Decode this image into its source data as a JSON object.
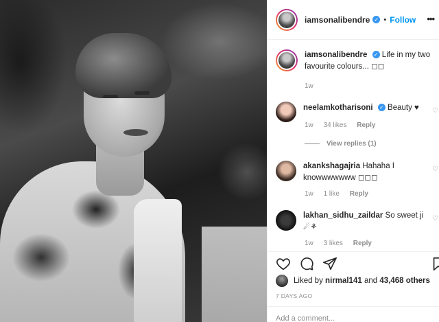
{
  "post": {
    "username": "iamsonalibendre",
    "follow_label": "Follow",
    "more_label": "•••",
    "caption": {
      "username": "iamsonalibendre",
      "text": "Life in my two favourite colours... ◻◻",
      "time": "1w"
    }
  },
  "comments": [
    {
      "username": "neelamkotharisoni",
      "verified": true,
      "text": "Beauty ♥",
      "time": "1w",
      "likes": "34 likes",
      "reply_label": "Reply",
      "view_replies": "View replies (1)"
    },
    {
      "username": "akankshagajria",
      "text": "Hahaha I knowwwwwww ◻◻◻",
      "time": "1w",
      "likes": "1 like",
      "reply_label": "Reply"
    },
    {
      "username": "lakhan_sidhu_zaildar",
      "text": "So sweet ji ☄⚘",
      "time": "1w",
      "likes": "3 likes",
      "reply_label": "Reply"
    }
  ],
  "actions": {
    "like_icon": "heart-icon",
    "comment_icon": "comment-icon",
    "share_icon": "share-icon",
    "save_icon": "bookmark-icon"
  },
  "likes": {
    "prefix": "Liked by",
    "liker": "nirmal141",
    "conjunction": "and",
    "others": "43,468 others"
  },
  "posted": "7 DAYS AGO",
  "add_comment_placeholder": "Add a comment..."
}
